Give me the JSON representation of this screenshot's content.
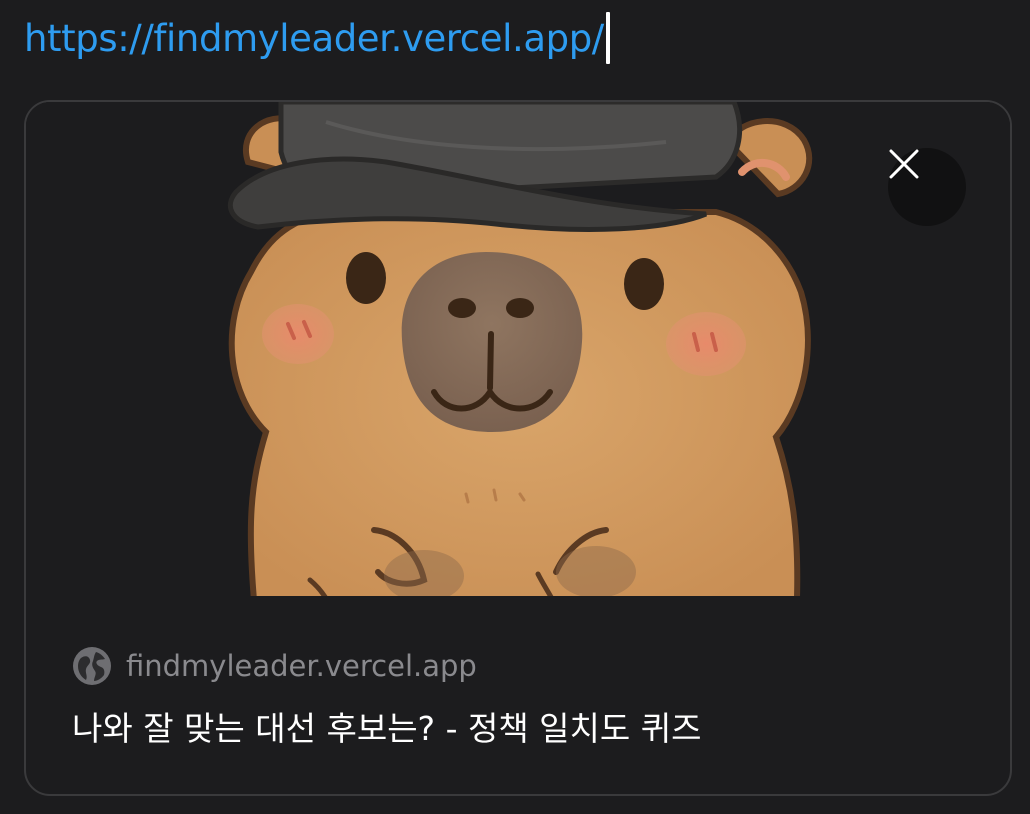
{
  "compose": {
    "url_text": "https://findmyleader.vercel.app/"
  },
  "link_preview": {
    "image_icon": "capybara-with-cap-illustration",
    "close_icon": "close-icon",
    "site_icon": "globe-icon",
    "domain": "findmyleader.vercel.app",
    "title": "나와 잘 맞는 대선 후보는? - 정책 일치도 퀴즈"
  },
  "colors": {
    "background": "#1c1c1e",
    "link_blue": "#2e9cf0",
    "card_border": "#3a3a3c",
    "domain_gray": "#8a8a8e",
    "title_white": "#ffffff"
  }
}
